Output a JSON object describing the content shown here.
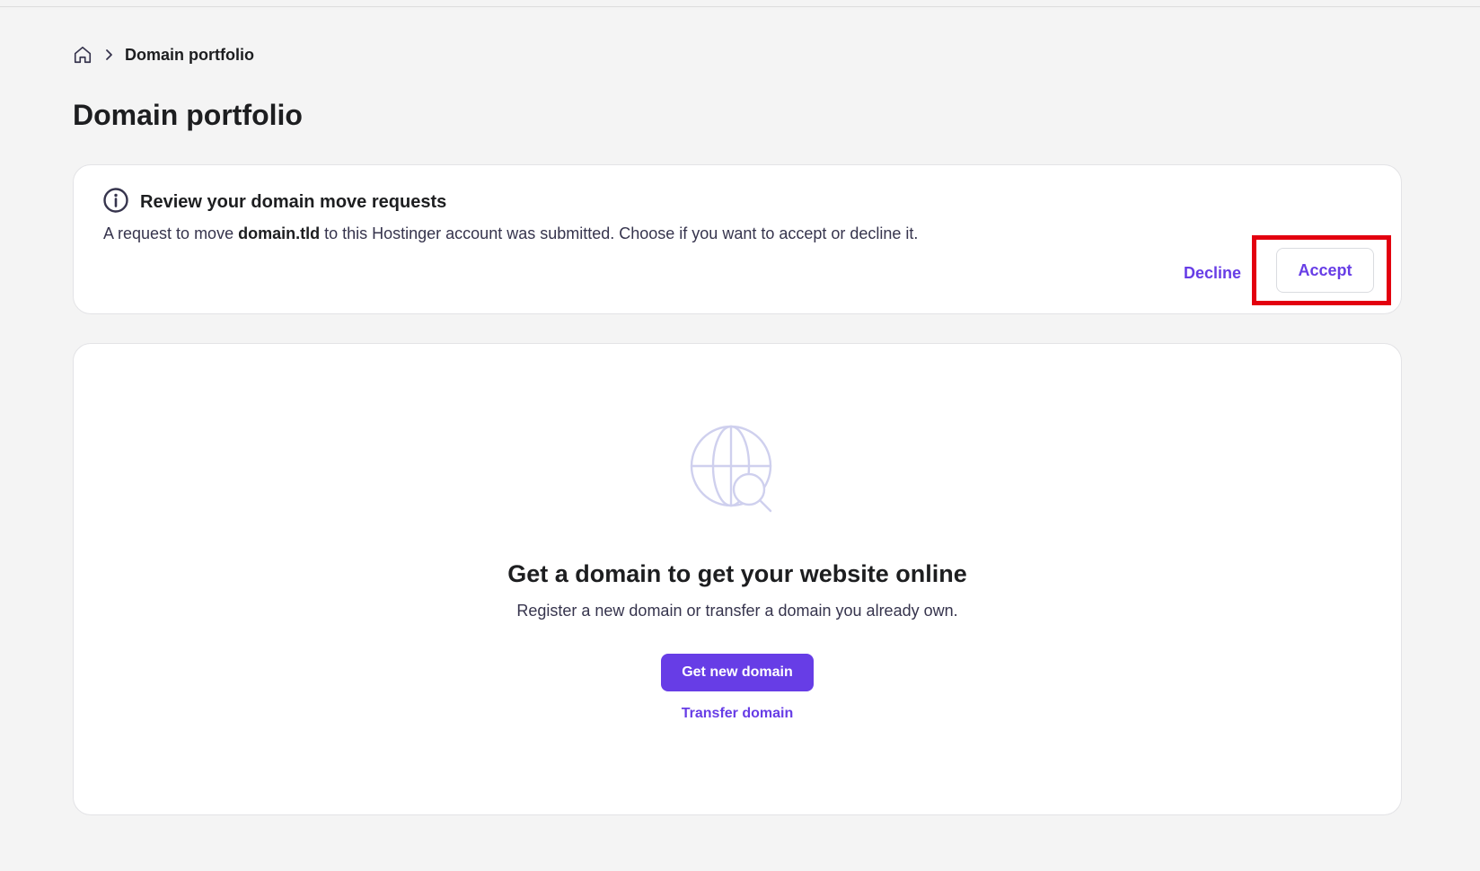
{
  "breadcrumb": {
    "current": "Domain portfolio"
  },
  "page": {
    "title": "Domain portfolio"
  },
  "notice": {
    "title": "Review your domain move requests",
    "text_before": "A request to move ",
    "domain": "domain.tld",
    "text_after": " to this Hostinger account was submitted. Choose if you want to accept or decline it.",
    "decline_label": "Decline",
    "accept_label": "Accept"
  },
  "empty_state": {
    "title": "Get a domain to get your website online",
    "subtitle": "Register a new domain or transfer a domain you already own.",
    "primary_label": "Get new domain",
    "secondary_label": "Transfer domain"
  },
  "icons": {
    "home": "home-icon",
    "chevron": "chevron-right-icon",
    "info": "info-icon",
    "globe": "globe-search-icon"
  },
  "colors": {
    "accent": "#673de6",
    "highlight": "#e3000f",
    "background": "#f4f4f4",
    "card": "#ffffff"
  }
}
